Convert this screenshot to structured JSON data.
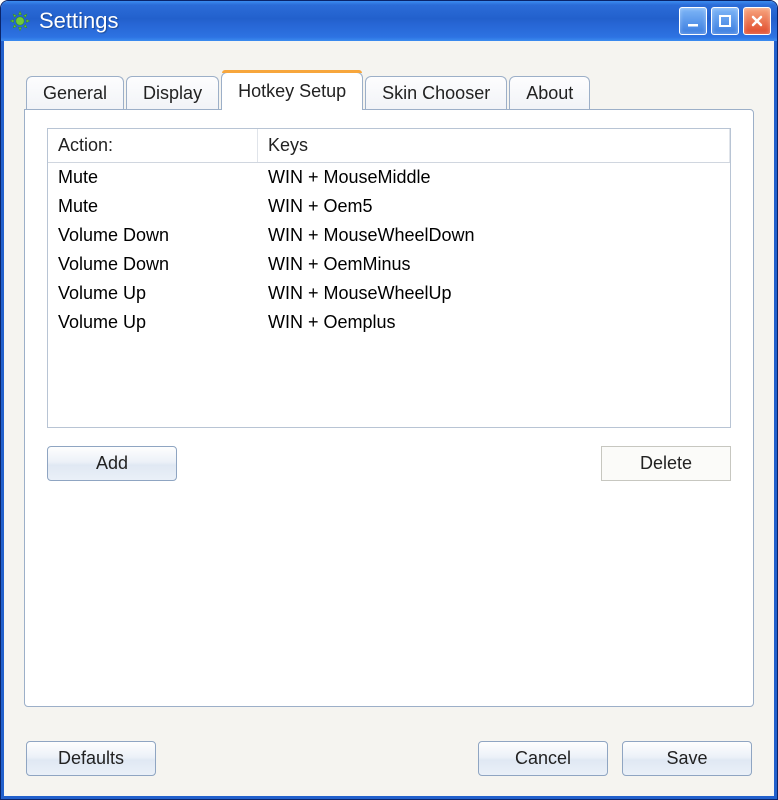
{
  "window": {
    "title": "Settings"
  },
  "tabs": {
    "general": "General",
    "display": "Display",
    "hotkey": "Hotkey Setup",
    "skin": "Skin Chooser",
    "about": "About",
    "active": "hotkey"
  },
  "hotkey_table": {
    "header_action": "Action:",
    "header_keys": "Keys",
    "rows": [
      {
        "action": "Mute",
        "keys": "WIN + MouseMiddle"
      },
      {
        "action": "Mute",
        "keys": "WIN + Oem5"
      },
      {
        "action": "Volume Down",
        "keys": "WIN + MouseWheelDown"
      },
      {
        "action": "Volume Down",
        "keys": "WIN + OemMinus"
      },
      {
        "action": "Volume Up",
        "keys": "WIN + MouseWheelUp"
      },
      {
        "action": "Volume Up",
        "keys": "WIN + Oemplus"
      }
    ]
  },
  "buttons": {
    "add": "Add",
    "delete": "Delete",
    "defaults": "Defaults",
    "cancel": "Cancel",
    "save": "Save"
  }
}
